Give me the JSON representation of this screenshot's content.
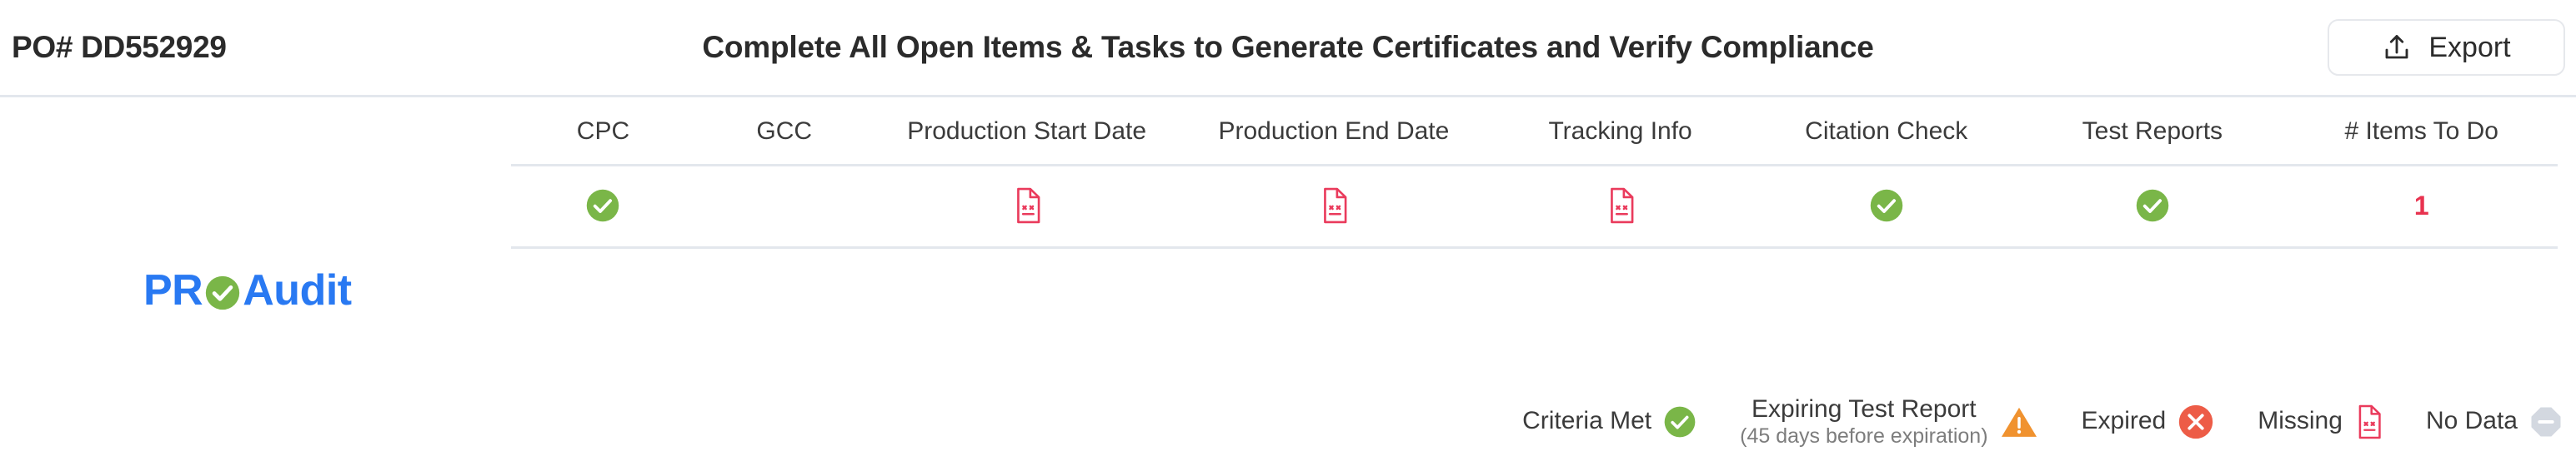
{
  "header": {
    "po_label": "PO# DD552929",
    "title": "Complete All Open Items & Tasks to Generate Certificates and Verify Compliance",
    "export_label": "Export",
    "export_icon": "upload-share-icon"
  },
  "logo": {
    "prefix": "PR",
    "suffix": " Audit",
    "mark_icon": "green-check-circle-icon",
    "color": "#2979f2",
    "mark_color": "#7ab648"
  },
  "table": {
    "columns": [
      {
        "key": "cpc",
        "label": "CPC"
      },
      {
        "key": "gcc",
        "label": "GCC"
      },
      {
        "key": "production_start_date",
        "label": "Production Start Date"
      },
      {
        "key": "production_end_date",
        "label": "Production End Date"
      },
      {
        "key": "tracking_info",
        "label": "Tracking Info"
      },
      {
        "key": "citation_check",
        "label": "Citation Check"
      },
      {
        "key": "test_reports",
        "label": "Test Reports"
      },
      {
        "key": "items_to_do",
        "label": "# Items To Do"
      }
    ],
    "rows": [
      {
        "cpc": {
          "status": "criteria-met",
          "icon": "green-check-circle-icon"
        },
        "gcc": {
          "status": "blank",
          "icon": ""
        },
        "production_start_date": {
          "status": "missing",
          "icon": "missing-document-icon"
        },
        "production_end_date": {
          "status": "missing",
          "icon": "missing-document-icon"
        },
        "tracking_info": {
          "status": "missing",
          "icon": "missing-document-icon"
        },
        "citation_check": {
          "status": "criteria-met",
          "icon": "green-check-circle-icon"
        },
        "test_reports": {
          "status": "criteria-met",
          "icon": "green-check-circle-icon"
        },
        "items_to_do": {
          "status": "count",
          "value": "1"
        }
      }
    ]
  },
  "legend": {
    "items": [
      {
        "label": "Criteria Met",
        "sub": "",
        "icon": "green-check-circle-icon",
        "color": "#7ab648"
      },
      {
        "label": "Expiring Test Report",
        "sub": "(45 days before expiration)",
        "icon": "orange-warning-triangle-icon",
        "color": "#f0922f"
      },
      {
        "label": "Expired",
        "sub": "",
        "icon": "red-x-circle-icon",
        "color": "#ed5c47"
      },
      {
        "label": "Missing",
        "sub": "",
        "icon": "missing-document-icon",
        "color": "#ea3b5c"
      },
      {
        "label": "No Data",
        "sub": "",
        "icon": "gray-dash-octagon-icon",
        "color": "#d3d8e0"
      }
    ]
  }
}
